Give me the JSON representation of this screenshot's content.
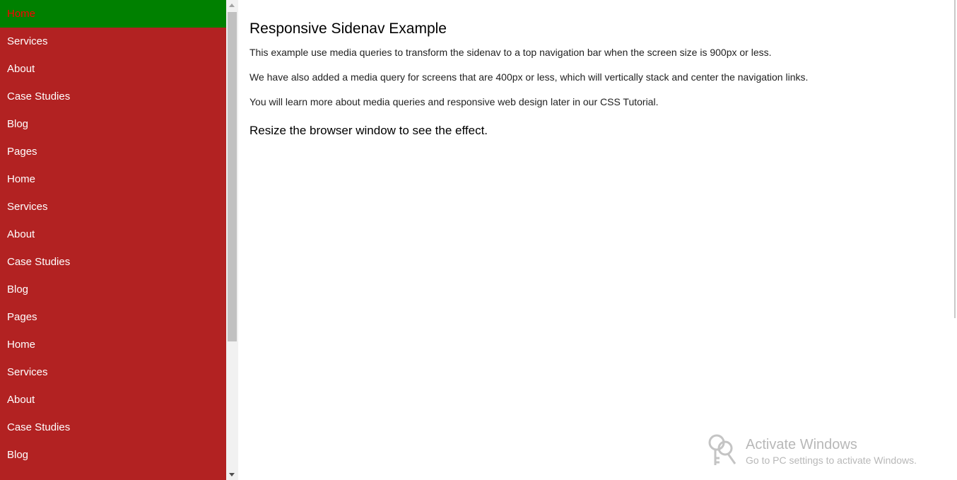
{
  "sidenav": {
    "active_color": "#008000",
    "background_color": "#b22222",
    "items": [
      {
        "label": "Home"
      },
      {
        "label": "Services"
      },
      {
        "label": "About"
      },
      {
        "label": "Case Studies"
      },
      {
        "label": "Blog"
      },
      {
        "label": "Pages"
      },
      {
        "label": "Home"
      },
      {
        "label": "Services"
      },
      {
        "label": "About"
      },
      {
        "label": "Case Studies"
      },
      {
        "label": "Blog"
      },
      {
        "label": "Pages"
      },
      {
        "label": "Home"
      },
      {
        "label": "Services"
      },
      {
        "label": "About"
      },
      {
        "label": "Case Studies"
      },
      {
        "label": "Blog"
      }
    ]
  },
  "main": {
    "title": "Responsive Sidenav Example",
    "paragraphs": [
      "This example use media queries to transform the sidenav to a top navigation bar when the screen size is 900px or less.",
      "We have also added a media query for screens that are 400px or less, which will vertically stack and center the navigation links.",
      "You will learn more about media queries and responsive web design later in our CSS Tutorial."
    ],
    "subheading": "Resize the browser window to see the effect."
  },
  "watermark": {
    "title": "Activate Windows",
    "subtitle": "Go to PC settings to activate Windows.",
    "icon": "key-icon"
  }
}
